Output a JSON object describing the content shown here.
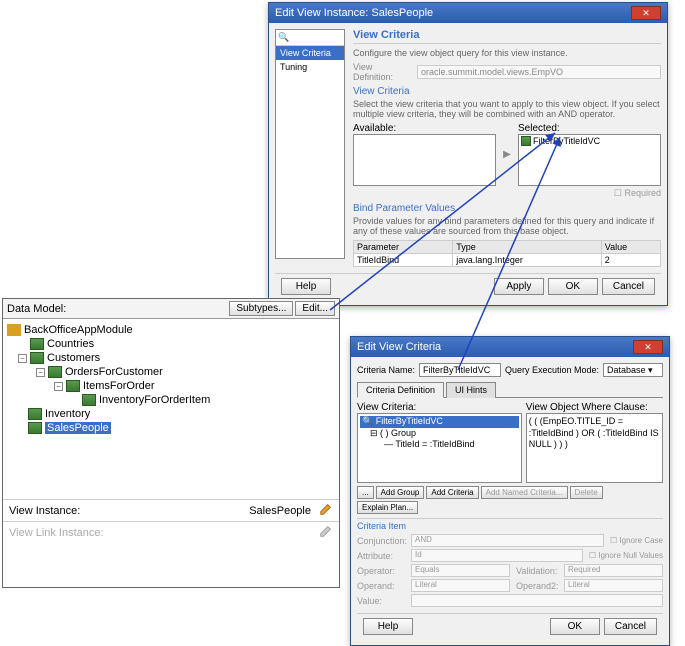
{
  "dlg1": {
    "title": "Edit View Instance: SalesPeople",
    "nav": {
      "search_icon": "🔍",
      "items": [
        "View Criteria",
        "Tuning"
      ]
    },
    "heading": "View Criteria",
    "subtitle": "Configure the view object query for this view instance.",
    "viewdef_lbl": "View Definition:",
    "viewdef_val": "oracle.summit.model.views.EmpVO",
    "sect_vc": "View Criteria",
    "vc_desc": "Select the view criteria that you want to apply to this view object. If you select multiple view criteria, they will be combined with an AND operator.",
    "avail_lbl": "Available:",
    "sel_lbl": "Selected:",
    "sel_item": "FilterByTitleIdVC",
    "required_lbl": "Required",
    "sect_bind": "Bind Parameter Values",
    "bind_desc": "Provide values for any bind parameters defined for this query and indicate if any of these values are sourced from this base object.",
    "param_cols": [
      "Parameter",
      "Type",
      "Value"
    ],
    "param_row": [
      "TitleIdBind",
      "java.lang.Integer",
      "2"
    ],
    "help": "Help",
    "apply": "Apply",
    "ok": "OK",
    "cancel": "Cancel"
  },
  "dm": {
    "title": "Data Model:",
    "subtypes": "Subtypes...",
    "edit": "Edit...",
    "tree": {
      "root": "BackOfficeAppModule",
      "n1": "Countries",
      "n2": "Customers",
      "n3": "OrdersForCustomer",
      "n4": "ItemsForOrder",
      "n5": "InventoryForOrderItem",
      "n6": "Inventory",
      "n7": "SalesPeople"
    },
    "vi_lbl": "View Instance:",
    "vi_val": "SalesPeople",
    "vl_lbl": "View Link Instance:"
  },
  "dlg2": {
    "title": "Edit View Criteria",
    "cn_lbl": "Criteria Name:",
    "cn_val": "FilterByTitleIdVC",
    "qem_lbl": "Query Execution Mode:",
    "qem_val": "Database",
    "tabs": [
      "Criteria Definition",
      "UI Hints"
    ],
    "vc_lbl": "View Criteria:",
    "vo_lbl": "View Object Where Clause:",
    "vc_root": "FilterByTitleIdVC",
    "vc_group": "( ) Group",
    "vc_item": "TitleId = :TitleIdBind",
    "vo_clause": "( ( (EmpEO.TITLE_ID = :TitleIdBind ) OR ( :TitleIdBind IS NULL ) ) )",
    "bbar": [
      "...",
      "Add Group",
      "Add Criteria",
      "Add Named Criteria...",
      "Delete",
      "Explain Plan..."
    ],
    "ci_lbl": "Criteria Item",
    "conj_lbl": "Conjunction:",
    "conj_val": "AND",
    "ic_lbl": "Ignore Case",
    "attr_lbl": "Attribute:",
    "attr_val": "Id",
    "inv_lbl": "Ignore Null Values",
    "op_lbl": "Operator:",
    "op_val": "Equals",
    "val_lbl": "Validation:",
    "val_val": "Required",
    "opd_lbl": "Operand:",
    "opd_val": "Literal",
    "opd2_lbl": "Operand2:",
    "opd2_val": "Literal",
    "vlbl": "Value:",
    "help": "Help",
    "ok": "OK",
    "cancel": "Cancel"
  }
}
